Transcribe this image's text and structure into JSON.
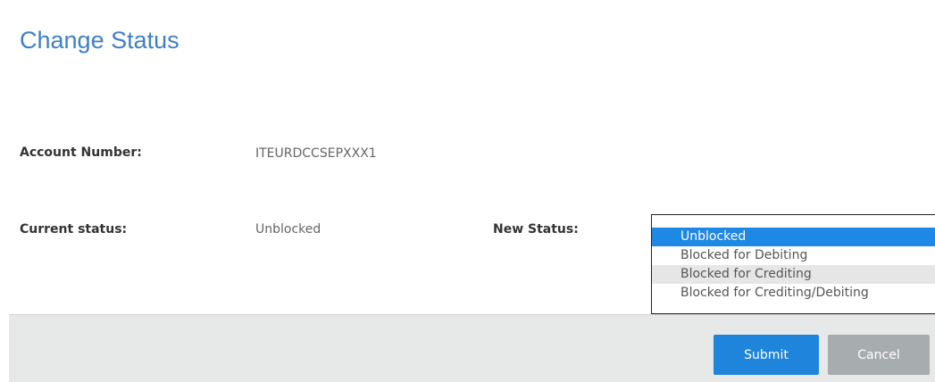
{
  "dialog": {
    "title": "Change Status"
  },
  "account": {
    "label": "Account Number:",
    "value": "ITEURDCCSEPXXX1"
  },
  "current_status": {
    "label": "Current status:",
    "value": "Unblocked"
  },
  "new_status": {
    "label": "New Status:",
    "options": [
      "Unblocked",
      "Blocked for Debiting",
      "Blocked for Crediting",
      "Blocked for Crediting/Debiting"
    ],
    "selected": "Unblocked",
    "hovered": "Blocked for Crediting"
  },
  "buttons": {
    "submit": "Submit",
    "cancel": "Cancel"
  },
  "colors": {
    "title": "#3f7fc7",
    "selected_option": "#1e88e5",
    "submit_button": "#1f84db",
    "cancel_button": "#a7acae",
    "footer": "#e7e9e8"
  }
}
